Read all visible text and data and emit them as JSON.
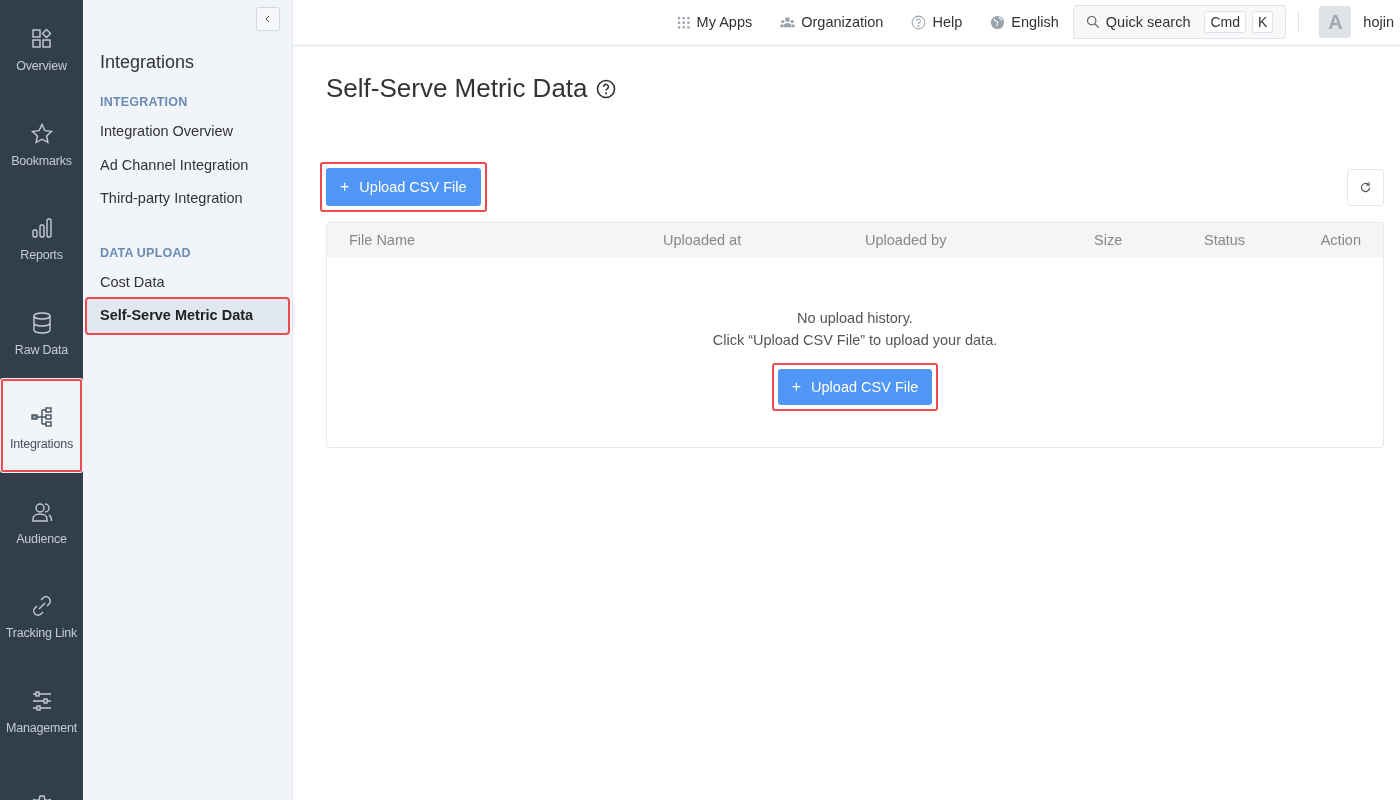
{
  "nav_rail": [
    {
      "kind": "overview",
      "label": "Overview",
      "selected": false,
      "highlighted": false
    },
    {
      "kind": "bookmarks",
      "label": "Bookmarks",
      "selected": false,
      "highlighted": false
    },
    {
      "kind": "reports",
      "label": "Reports",
      "selected": false,
      "highlighted": false
    },
    {
      "kind": "raw-data",
      "label": "Raw Data",
      "selected": false,
      "highlighted": false
    },
    {
      "kind": "integrations",
      "label": "Integrations",
      "selected": true,
      "highlighted": true
    },
    {
      "kind": "audience",
      "label": "Audience",
      "selected": false,
      "highlighted": false
    },
    {
      "kind": "tracking-link",
      "label": "Tracking Link",
      "selected": false,
      "highlighted": false
    },
    {
      "kind": "management",
      "label": "Management",
      "selected": false,
      "highlighted": false
    },
    {
      "kind": "settings",
      "selected": false,
      "highlighted": false
    }
  ],
  "sidebar": {
    "title": "Integrations",
    "sections": [
      {
        "heading": "INTEGRATION",
        "items": [
          {
            "label": "Integration Overview",
            "selected": false,
            "highlighted": false
          },
          {
            "label": "Ad Channel Integration",
            "selected": false,
            "highlighted": false
          },
          {
            "label": "Third-party Integration",
            "selected": false,
            "highlighted": false
          }
        ]
      },
      {
        "heading": "DATA UPLOAD",
        "items": [
          {
            "label": "Cost Data",
            "selected": false,
            "highlighted": false
          },
          {
            "label": "Self-Serve Metric Data",
            "selected": true,
            "highlighted": true
          }
        ]
      }
    ]
  },
  "topbar": {
    "links": [
      {
        "kind": "apps",
        "label": "My Apps"
      },
      {
        "kind": "organization",
        "label": "Organization"
      },
      {
        "kind": "help",
        "label": "Help"
      },
      {
        "kind": "language",
        "label": "English"
      }
    ],
    "search": {
      "placeholder": "Quick search",
      "keys": [
        "Cmd",
        "K"
      ]
    },
    "user": {
      "avatar": "A",
      "name": "hojin"
    }
  },
  "page": {
    "title": "Self-Serve Metric Data",
    "upload_button": {
      "label": "Upload CSV File",
      "icon": "+",
      "highlighted": true
    },
    "table": {
      "columns": [
        "File Name",
        "Uploaded at",
        "Uploaded by",
        "Size",
        "Status",
        "Action"
      ],
      "empty": {
        "message": "No upload history.",
        "hint": "Click “Upload CSV File” to upload your data.",
        "button": {
          "label": "Upload CSV File",
          "icon": "+",
          "highlighted": true
        }
      }
    }
  }
}
